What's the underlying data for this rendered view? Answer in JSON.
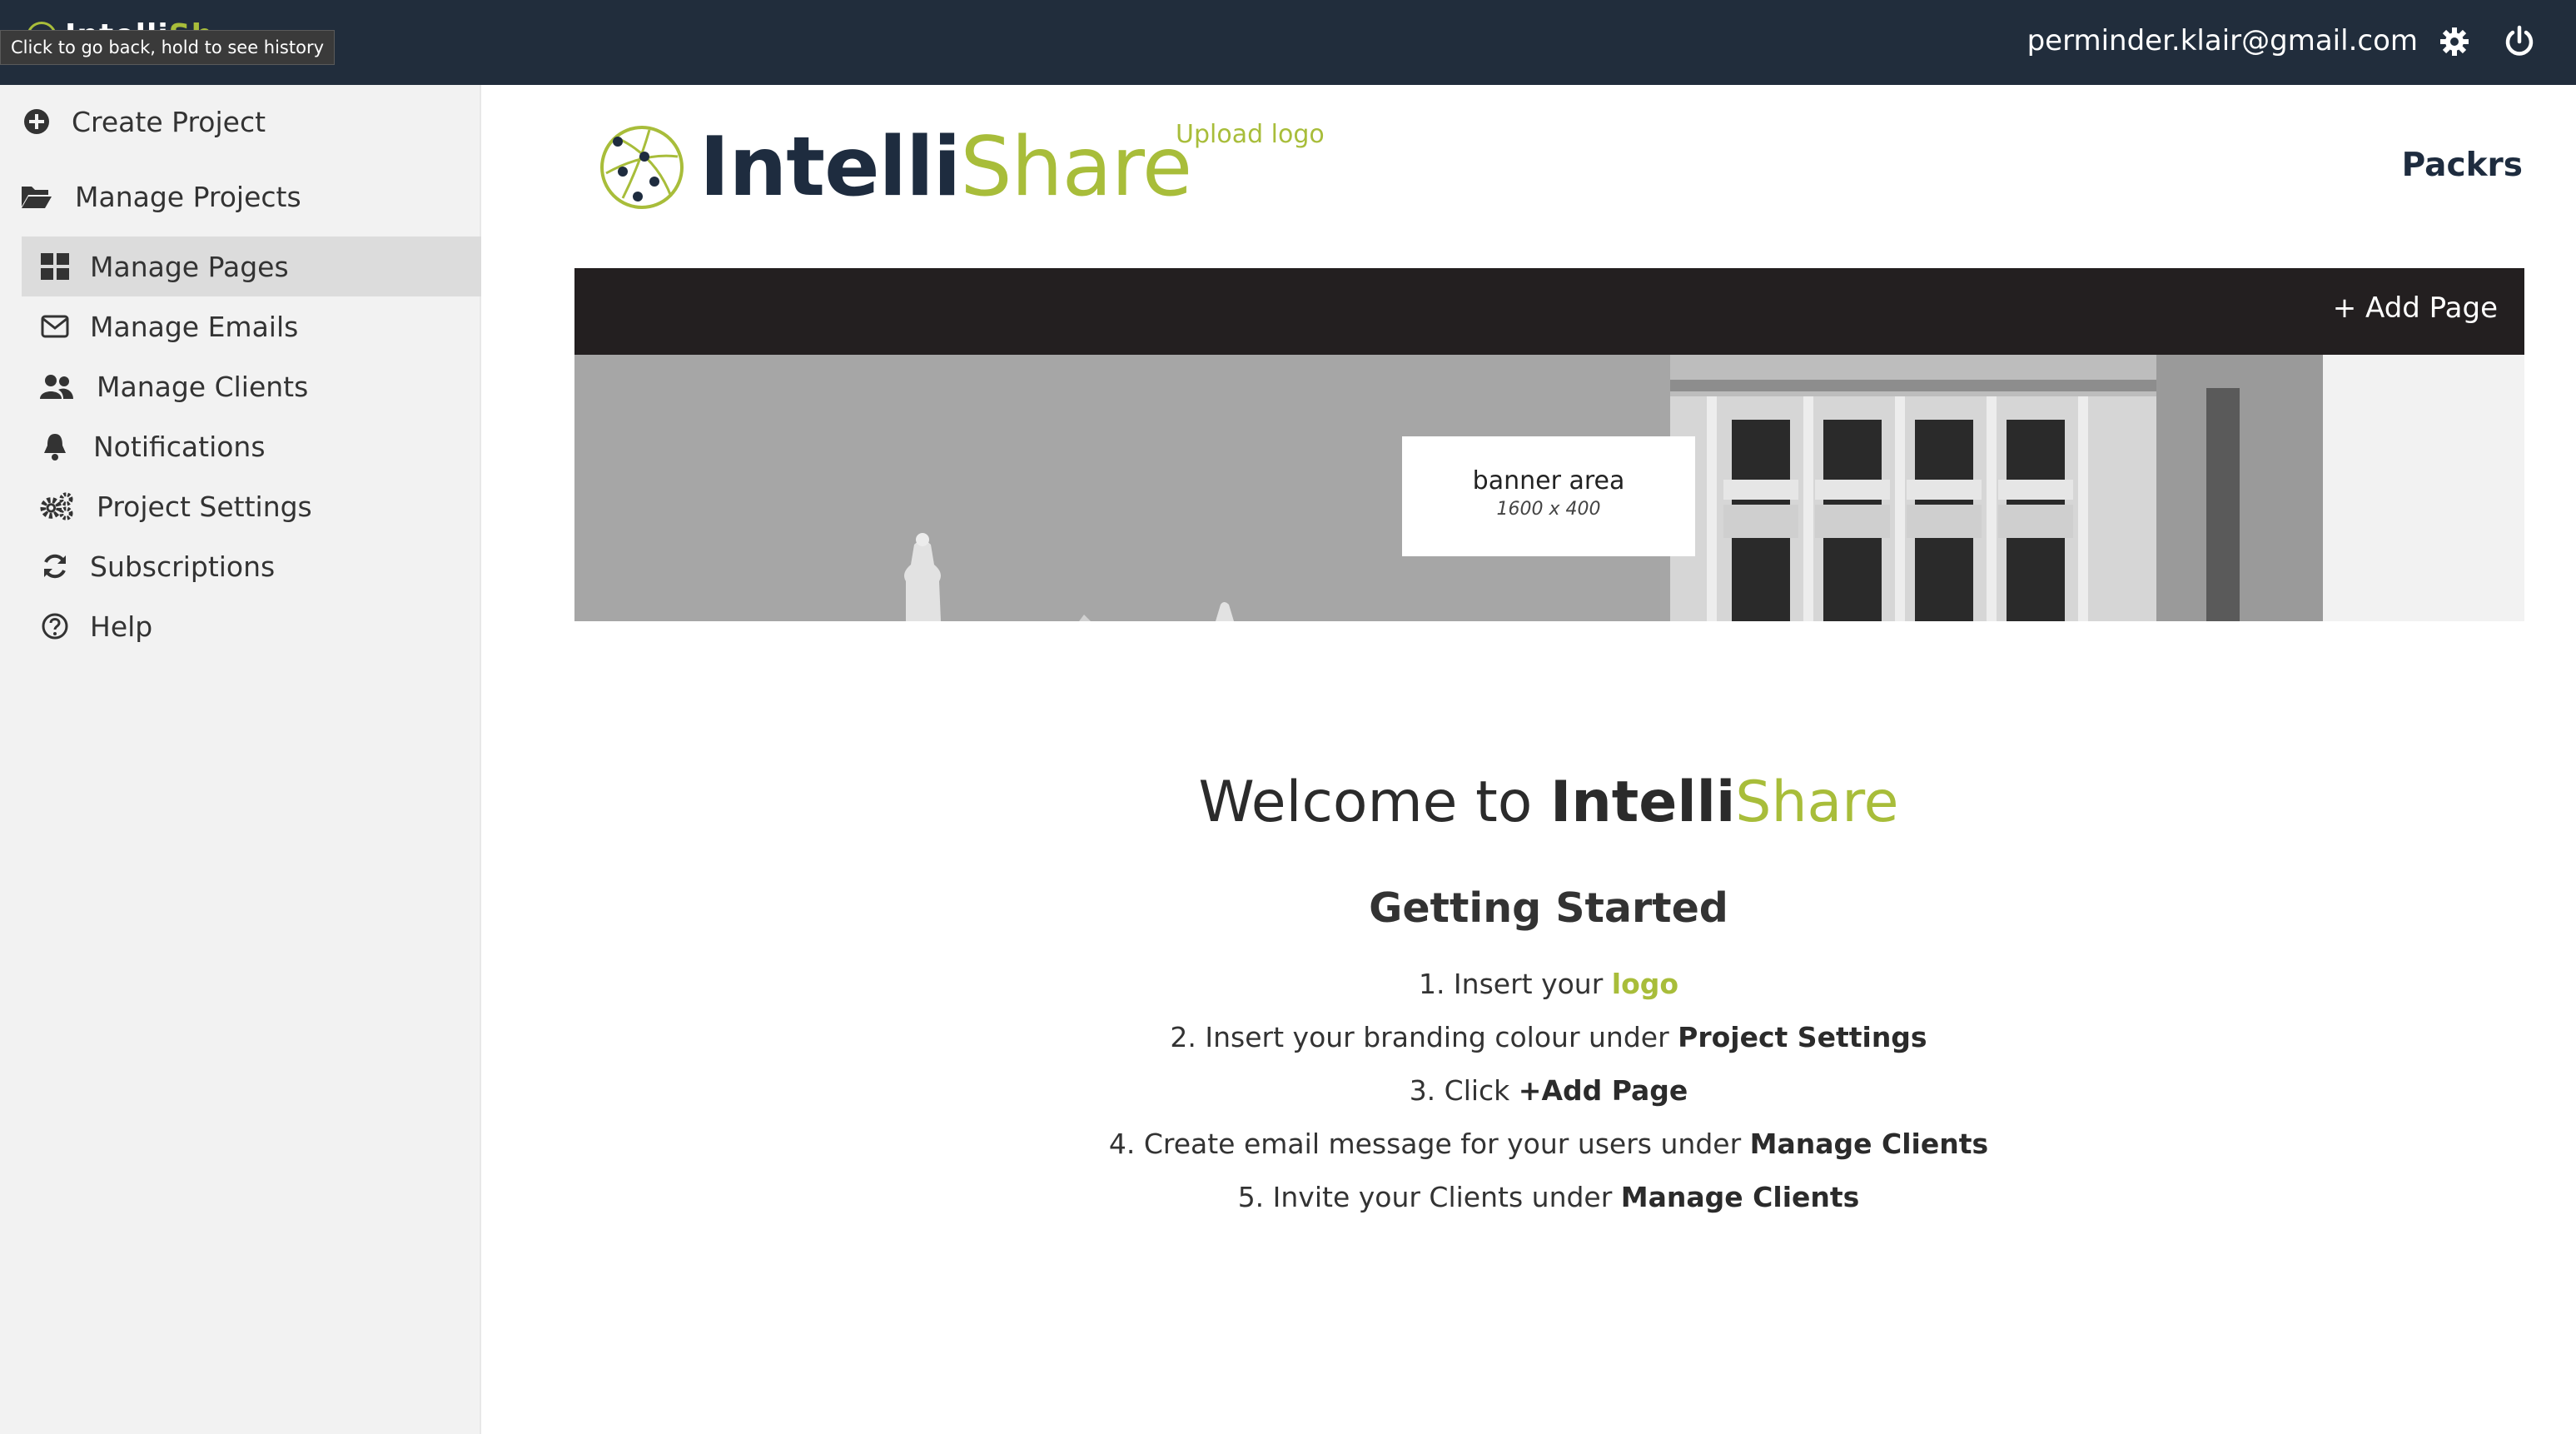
{
  "topbar": {
    "tooltip": "Click to go back, hold to see history",
    "user_email": "perminder.klair@gmail.com",
    "logo_part1": "Intelli",
    "logo_part2": "Sh"
  },
  "sidebar": {
    "items": [
      {
        "label": "Create Project",
        "icon": "plus-circle-icon"
      },
      {
        "label": "Manage Projects",
        "icon": "folder-open-icon"
      },
      {
        "label": "Manage Pages",
        "icon": "grid-icon"
      },
      {
        "label": "Manage Emails",
        "icon": "envelope-icon"
      },
      {
        "label": "Manage Clients",
        "icon": "users-icon"
      },
      {
        "label": "Notifications",
        "icon": "bell-icon"
      },
      {
        "label": "Project Settings",
        "icon": "cogs-icon"
      },
      {
        "label": "Subscriptions",
        "icon": "refresh-icon"
      },
      {
        "label": "Help",
        "icon": "question-circle-icon"
      }
    ]
  },
  "brand": {
    "part1": "Intelli",
    "part2": "Share",
    "upload_logo": "Upload logo",
    "project_name": "Packrs"
  },
  "pagebar": {
    "add_page": "+ Add Page"
  },
  "banner": {
    "label": "banner area",
    "size": "1600 x 400"
  },
  "welcome": {
    "prefix": "Welcome to ",
    "brand1": "Intelli",
    "brand2": "Share",
    "heading": "Getting Started",
    "steps": [
      {
        "text": "1. Insert your ",
        "em": "logo"
      },
      {
        "text": "2. Insert your branding colour under ",
        "em": "Project Settings"
      },
      {
        "text": "3. Click ",
        "em": "+Add Page"
      },
      {
        "text": "4. Create email message for your users under ",
        "em": "Manage Clients"
      },
      {
        "text": "5. Invite your Clients under ",
        "em": "Manage Clients"
      }
    ]
  },
  "colors": {
    "topbar": "#212d3c",
    "accent": "#a8bd3a",
    "navy": "#1e2c3f",
    "pagebar": "#231f20",
    "sidebar": "#f2f2f2"
  }
}
